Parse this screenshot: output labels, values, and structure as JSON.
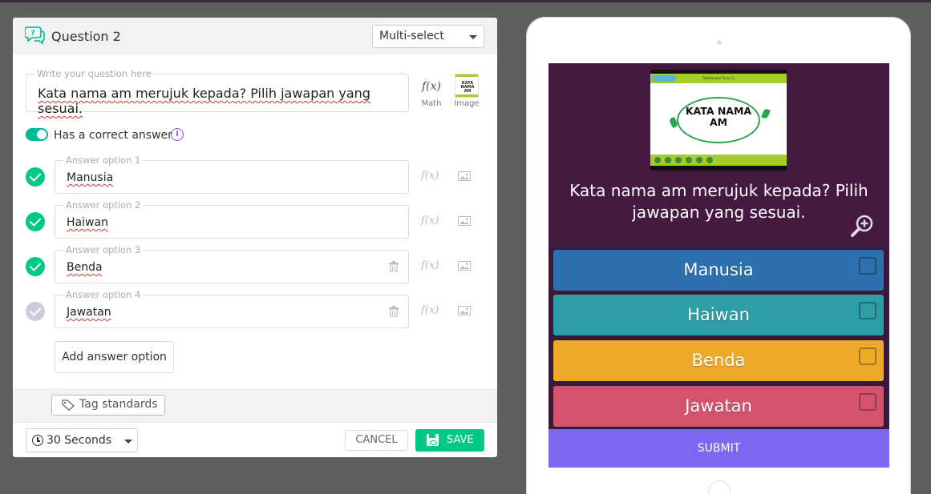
{
  "editor": {
    "question_title": "Question 2",
    "question_type": "Multi-select",
    "question_field_label": "Write your question here",
    "question_text": "Kata nama am merujuk kepada? Pilih jawapan yang sesuai.",
    "math_label": "Math",
    "math_symbol": "f(x)",
    "image_label": "Image",
    "image_thumb_text": "KATA NAMA AM",
    "correct_answer_label": "Has a correct answer",
    "info_symbol": "i",
    "options": [
      {
        "label": "Answer option 1",
        "value": "Manusia",
        "correct": true
      },
      {
        "label": "Answer option 2",
        "value": "Haiwan",
        "correct": true
      },
      {
        "label": "Answer option 3",
        "value": "Benda",
        "correct": true
      },
      {
        "label": "Answer option 4",
        "value": "Jawatan",
        "correct": false
      }
    ],
    "add_option_label": "Add answer option",
    "tag_label": "Tag standards",
    "timer": "30 Seconds",
    "cancel_label": "CANCEL",
    "save_label": "SAVE"
  },
  "preview": {
    "question_text": "Kata nama am merujuk kepada? Pilih jawapan yang sesuai.",
    "image_title": "KATA NAMA AM",
    "image_header": "Tatabahasa Tahun 1",
    "options": [
      {
        "value": "Manusia",
        "color": "#2d70ae"
      },
      {
        "value": "Haiwan",
        "color": "#2d9da6"
      },
      {
        "value": "Benda",
        "color": "#efa929"
      },
      {
        "value": "Jawatan",
        "color": "#d5546d"
      }
    ],
    "submit_label": "SUBMIT"
  },
  "colors": {
    "accent_green": "#00c985",
    "toggle_green": "#00b894",
    "purple": "#8854c0",
    "submit": "#7b68ee",
    "preview_bg": "#461a40"
  }
}
